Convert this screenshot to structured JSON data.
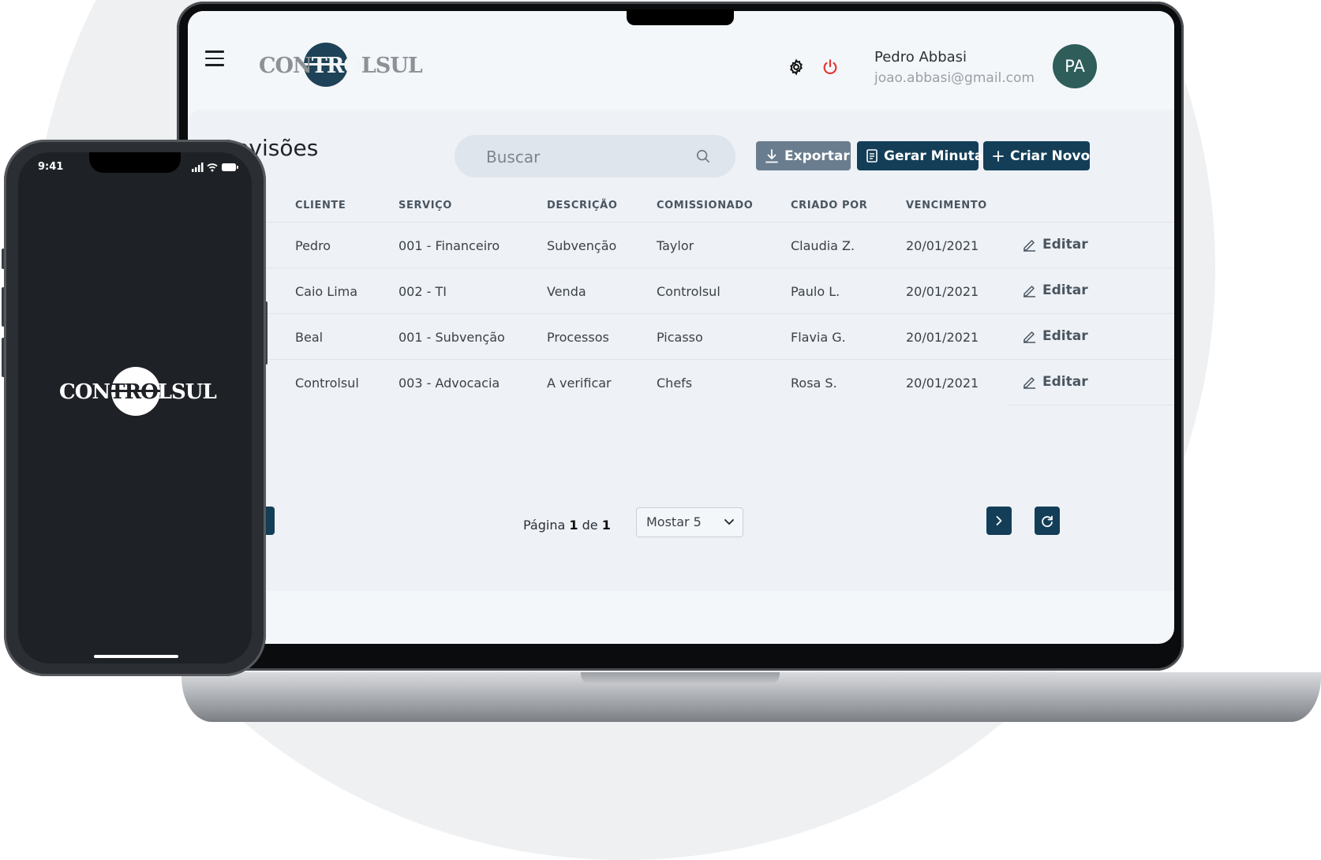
{
  "app": {
    "logo_text_left": "CON",
    "logo_text_mid": "TRO",
    "logo_text_right": "LSUL"
  },
  "header": {
    "user_name": "Pedro Abbasi",
    "user_email": "joao.abbasi@gmail.com",
    "avatar_initials": "PA",
    "icons": [
      "menu-icon",
      "gear-icon",
      "power-icon"
    ]
  },
  "page": {
    "title": "Revisões",
    "search_placeholder": "Buscar"
  },
  "toolbar": {
    "export_label": "Exportar",
    "minuta_label": "Gerar Minuta",
    "new_label": "Criar Novo"
  },
  "table": {
    "columns": [
      "CLIENTE",
      "SERVIÇO",
      "DESCRIÇÃO",
      "COMISSIONADO",
      "CRIADO POR",
      "VENCIMENTO"
    ],
    "edit_label": "Editar",
    "rows": [
      {
        "cliente": "Pedro",
        "servico": "001 - Financeiro",
        "descricao": "Subvenção",
        "comissionado": "Taylor",
        "criado_por": "Claudia Z.",
        "vencimento": "20/01/2021"
      },
      {
        "cliente": "Caio Lima",
        "servico": "002 - TI",
        "descricao": "Venda",
        "comissionado": "Controlsul",
        "criado_por": "Paulo L.",
        "vencimento": "20/01/2021"
      },
      {
        "cliente": "Beal",
        "servico": "001 - Subvenção",
        "descricao": "Processos",
        "comissionado": "Picasso",
        "criado_por": "Flavia G.",
        "vencimento": "20/01/2021"
      },
      {
        "cliente": "Controlsul",
        "servico": "003 - Advocacia",
        "descricao": "A verificar",
        "comissionado": "Chefs",
        "criado_por": "Rosa S.",
        "vencimento": "20/01/2021"
      }
    ]
  },
  "pagination": {
    "prefix": "Página",
    "current": "1",
    "sep": "de",
    "total": "1",
    "page_size_selected": "Mostar 5"
  },
  "phone": {
    "time": "9:41",
    "logo_left": "CON",
    "logo_mid": "TRO",
    "logo_right": "LSUL"
  },
  "colors": {
    "primary": "#143e57",
    "export_button": "#6a7d8f",
    "power_icon": "#e53935",
    "avatar": "#2e5d5a"
  }
}
